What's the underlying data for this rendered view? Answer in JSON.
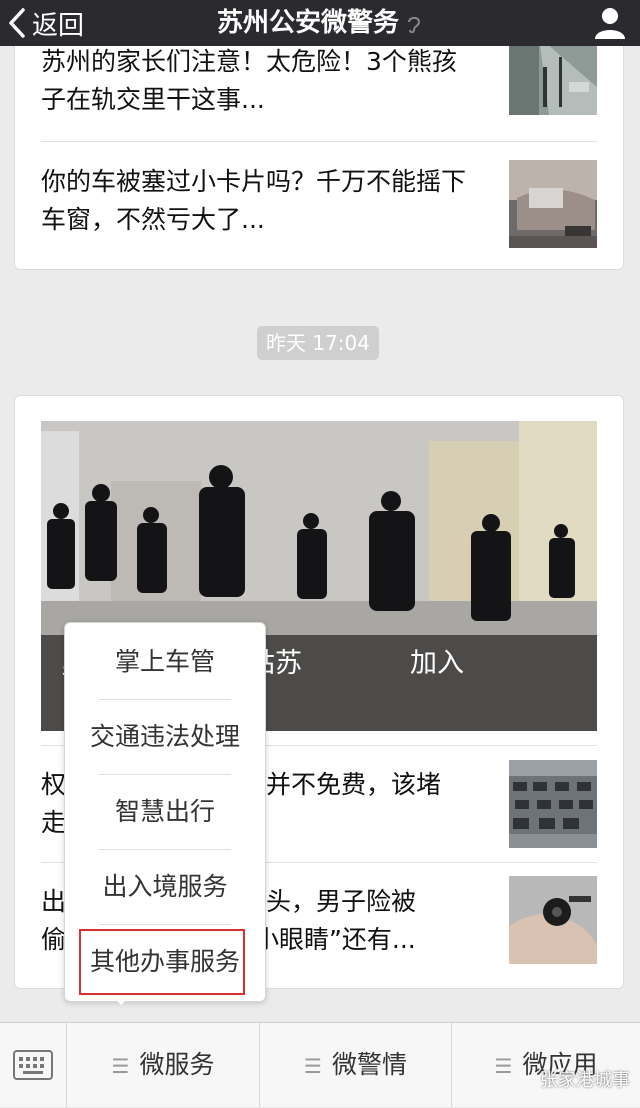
{
  "header": {
    "back_label": "返回",
    "title": "苏州公安微警务"
  },
  "feed": {
    "card1": {
      "items": [
        {
          "text": "苏州的家长们注意！太危险！3个熊孩子在轨交里干这事..."
        },
        {
          "text": "你的车被塞过小卡片吗？千万不能摇下车窗，不然亏大了..."
        }
      ]
    },
    "timestamp": "昨天 17:04",
    "card2": {
      "hero_caption": "，苏州市公安局姑苏　　　　加入",
      "items": [
        {
          "text": "权　　　　　　　速并不免费，该堵　　　　　　　走最顺畅?"
        },
        {
          "text": "出　　　　　　　像头，男子险被偷　　　　　　　“小眼睛”还有..."
        }
      ]
    }
  },
  "popup_menu": {
    "items": [
      "掌上车管",
      "交通违法处理",
      "智慧出行",
      "出入境服务",
      "其他办事服务"
    ],
    "highlighted_index": 4,
    "highlight_color": "#d83030"
  },
  "bottom_menu": {
    "tabs": [
      "微服务",
      "微警情",
      "微应用"
    ]
  },
  "watermark": "张家港城事",
  "colors": {
    "header_bg": "#2b2b2f",
    "page_bg": "#ebebeb"
  },
  "icons": [
    "back-chevron-icon",
    "ear-icon",
    "user-icon",
    "keyboard-icon",
    "menu-lines-icon"
  ]
}
